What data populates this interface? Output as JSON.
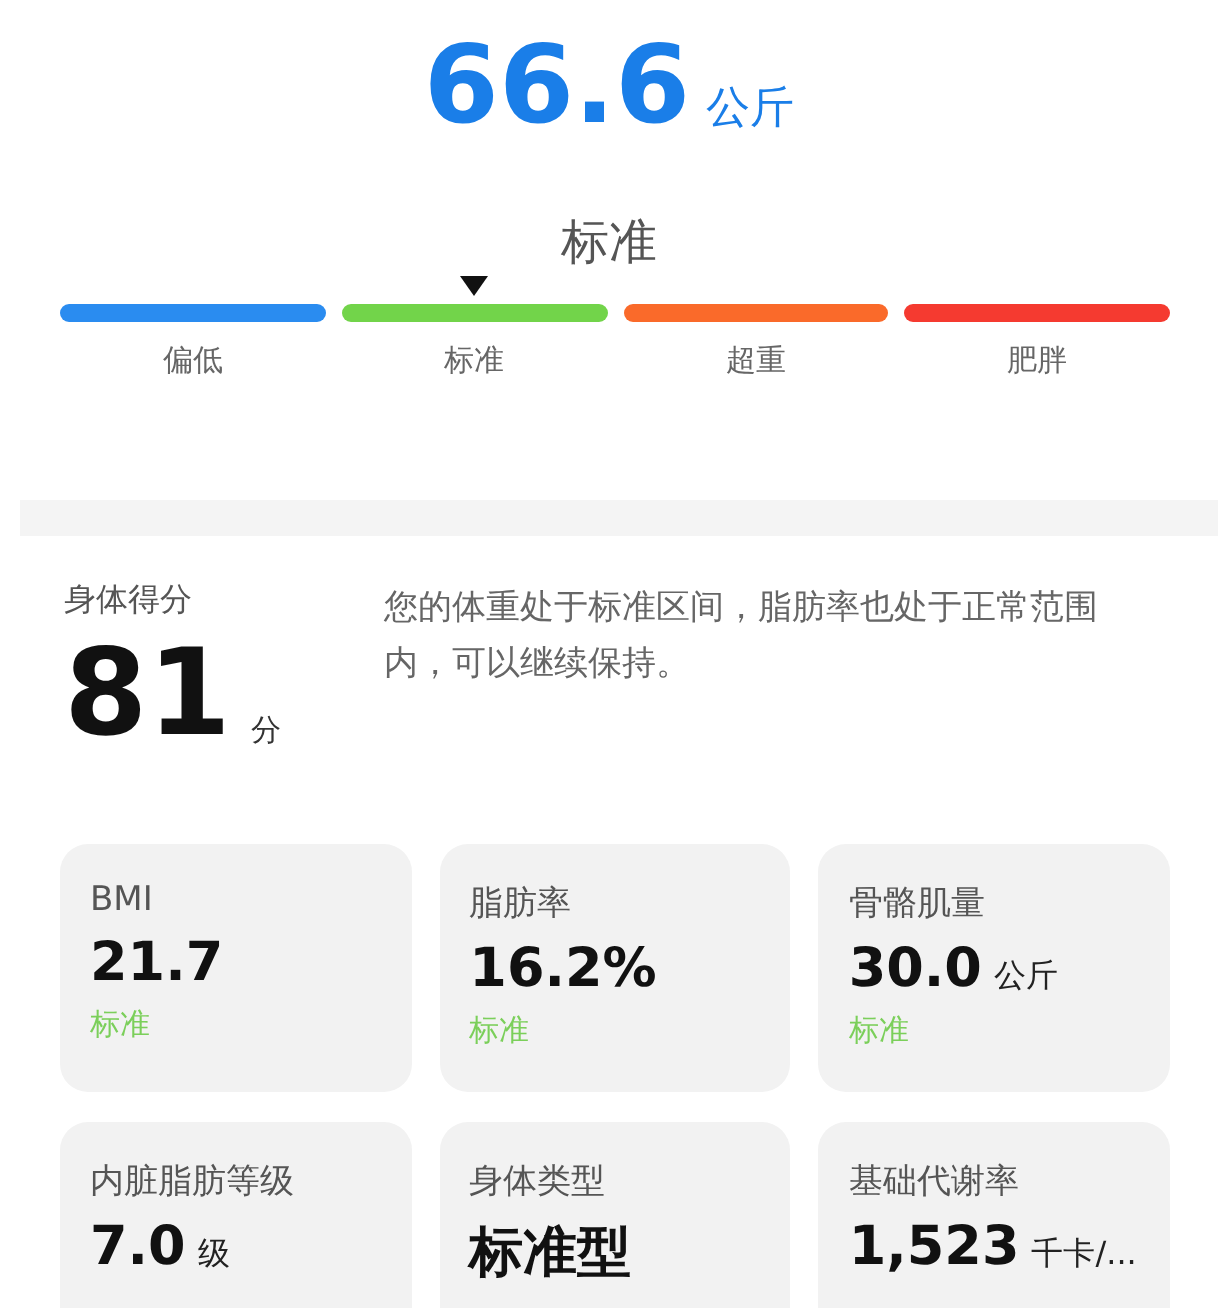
{
  "weight": {
    "value": "66.6",
    "unit": "公斤"
  },
  "scale": {
    "status": "标准",
    "segments": [
      {
        "label": "偏低",
        "color": "#2a8cf0",
        "selected": false
      },
      {
        "label": "标准",
        "color": "#72d44a",
        "selected": true
      },
      {
        "label": "超重",
        "color": "#fa6a2a",
        "selected": false
      },
      {
        "label": "肥胖",
        "color": "#f53a30",
        "selected": false
      }
    ]
  },
  "score": {
    "label": "身体得分",
    "value": "81",
    "unit": "分",
    "description": "您的体重处于标准区间，脂肪率也处于正常范围内，可以继续保持。"
  },
  "metrics": [
    {
      "label": "BMI",
      "value": "21.7",
      "status": "标准"
    },
    {
      "label": "脂肪率",
      "value": "16.2%",
      "status": "标准"
    },
    {
      "label": "骨骼肌量",
      "value": "30.0",
      "unit": "公斤",
      "status": "标准"
    },
    {
      "label": "内脏脂肪等级",
      "value": "7.0",
      "unit": "级"
    },
    {
      "label": "身体类型",
      "value": "标准型"
    },
    {
      "label": "基础代谢率",
      "value": "1,523",
      "unit": "千卡/..."
    }
  ]
}
